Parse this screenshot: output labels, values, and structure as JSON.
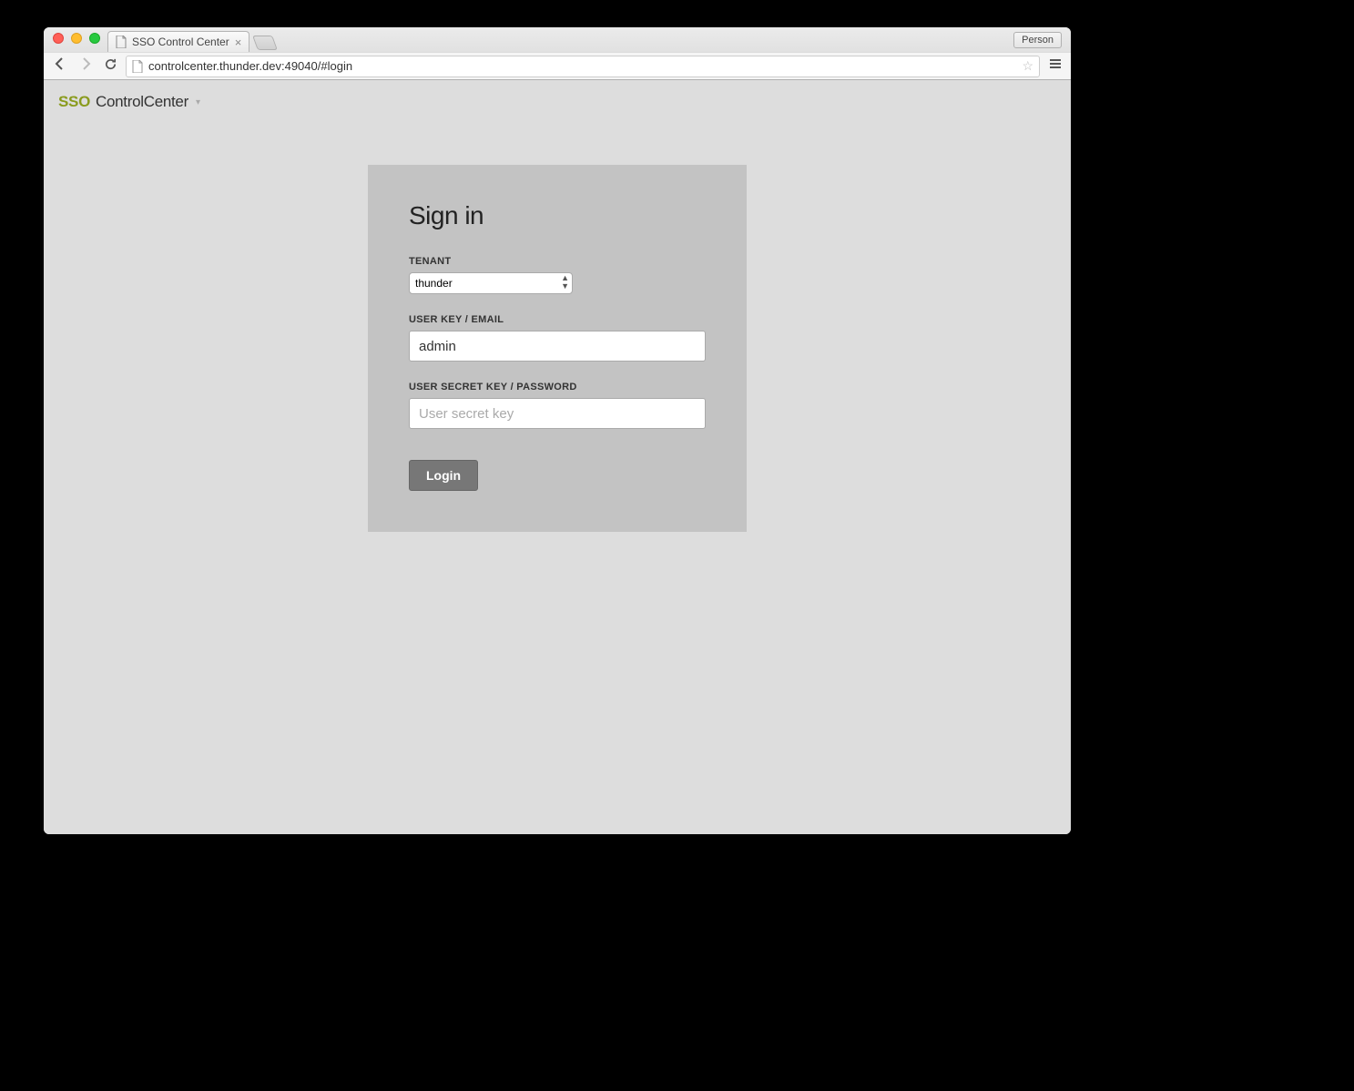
{
  "browser": {
    "tab_title": "SSO Control Center",
    "person_label": "Person",
    "url_display": "controlcenter.thunder.dev:49040/#login"
  },
  "header": {
    "brand_sso": "SSO",
    "brand_cc": "ControlCenter"
  },
  "signin": {
    "title": "Sign in",
    "tenant_label": "TENANT",
    "tenant_value": "thunder",
    "userkey_label": "USER KEY / EMAIL",
    "userkey_value": "admin",
    "secret_label": "USER SECRET KEY / PASSWORD",
    "secret_placeholder": "User secret key",
    "login_button": "Login"
  }
}
